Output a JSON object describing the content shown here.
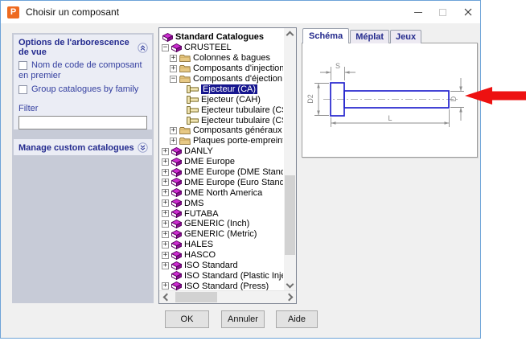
{
  "window": {
    "title": "Choisir un composant",
    "app_icon_letter": "P"
  },
  "sidebar": {
    "options_group": {
      "title": "Options de l'arborescence de vue",
      "checkboxes": [
        {
          "label": "Nom de code de composant en premier",
          "checked": false
        },
        {
          "label": "Group catalogues by family",
          "checked": false
        }
      ],
      "filter_label": "Filter",
      "filter_value": ""
    },
    "manage_group": {
      "title": "Manage custom catalogues"
    }
  },
  "tree": {
    "items": [
      {
        "label": "Standard Catalogues",
        "icon": "book",
        "level": 0,
        "expander": "none",
        "bold": true
      },
      {
        "label": "CRUSTEEL",
        "icon": "book",
        "level": 1,
        "expander": "minus"
      },
      {
        "label": "Colonnes & bagues",
        "icon": "folder",
        "level": 2,
        "expander": "plus"
      },
      {
        "label": "Composants d'injection",
        "icon": "folder",
        "level": 2,
        "expander": "plus"
      },
      {
        "label": "Composants d'éjection",
        "icon": "folder",
        "level": 2,
        "expander": "minus"
      },
      {
        "label": "Ejecteur (CA)",
        "icon": "pin",
        "level": 3,
        "expander": "none",
        "selected": true
      },
      {
        "label": "Ejecteur (CAH)",
        "icon": "pin",
        "level": 3,
        "expander": "none"
      },
      {
        "label": "Ejecteur tubulaire (CS)",
        "icon": "pin",
        "level": 3,
        "expander": "none"
      },
      {
        "label": "Ejecteur tubulaire (CSH)",
        "icon": "pin",
        "level": 3,
        "expander": "none"
      },
      {
        "label": "Composants généraux",
        "icon": "folder",
        "level": 2,
        "expander": "plus"
      },
      {
        "label": "Plaques porte-empreinte ple",
        "icon": "folder",
        "level": 2,
        "expander": "plus"
      },
      {
        "label": "DANLY",
        "icon": "book",
        "level": 1,
        "expander": "plus"
      },
      {
        "label": "DME Europe",
        "icon": "book",
        "level": 1,
        "expander": "plus"
      },
      {
        "label": "DME Europe (DME Standard)",
        "icon": "book",
        "level": 1,
        "expander": "plus"
      },
      {
        "label": "DME Europe (Euro Standard)",
        "icon": "book",
        "level": 1,
        "expander": "plus"
      },
      {
        "label": "DME North America",
        "icon": "book",
        "level": 1,
        "expander": "plus"
      },
      {
        "label": "DMS",
        "icon": "book",
        "level": 1,
        "expander": "plus"
      },
      {
        "label": "FUTABA",
        "icon": "book",
        "level": 1,
        "expander": "plus"
      },
      {
        "label": "GENERIC (Inch)",
        "icon": "book",
        "level": 1,
        "expander": "plus"
      },
      {
        "label": "GENERIC (Metric)",
        "icon": "book",
        "level": 1,
        "expander": "plus"
      },
      {
        "label": "HALES",
        "icon": "book",
        "level": 1,
        "expander": "plus"
      },
      {
        "label": "HASCO",
        "icon": "book",
        "level": 1,
        "expander": "plus"
      },
      {
        "label": "ISO Standard",
        "icon": "book",
        "level": 1,
        "expander": "plus"
      },
      {
        "label": "ISO Standard (Plastic Injection",
        "icon": "book",
        "level": 1,
        "expander": "none"
      },
      {
        "label": "ISO Standard (Press)",
        "icon": "book",
        "level": 1,
        "expander": "plus"
      }
    ]
  },
  "preview": {
    "tabs": [
      {
        "label": "Schéma",
        "active": true
      },
      {
        "label": "Méplat",
        "active": false
      },
      {
        "label": "Jeux",
        "active": false
      }
    ],
    "schematic": {
      "dim_labels": {
        "s": "S",
        "d2": "D2",
        "d": "D",
        "l": "L"
      },
      "shape_color": "#2424ce",
      "dim_color": "#8f8f8f"
    }
  },
  "footer": {
    "buttons": {
      "ok": "OK",
      "cancel": "Annuler",
      "help": "Aide"
    }
  },
  "annotation_arrow": {
    "color": "#ed1111"
  },
  "colors": {
    "window_border": "#6da3d8",
    "dialog_bg": "#f0f0f0",
    "sidebar_bg": "#c7cbd7",
    "group_bg": "#ebedf5",
    "header_text": "#232a8e",
    "label_text": "#3540a0",
    "selection_bg": "#16168e",
    "selection_text": "#ffffff",
    "app_icon_bg": "#ee6a1f"
  }
}
